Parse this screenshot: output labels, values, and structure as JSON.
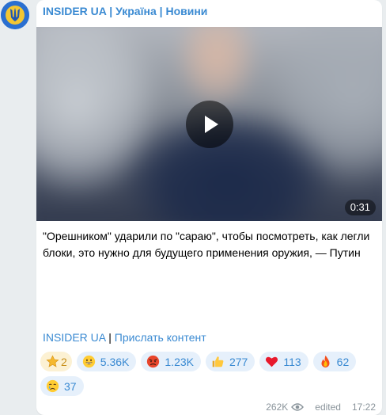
{
  "channel": {
    "name": "INSIDER UA | Україна | Новини"
  },
  "video": {
    "duration": "0:31"
  },
  "message": {
    "text": "\"Орешником\" ударили по \"сараю\", чтобы посмотреть, как легли блоки, это нужно для будущего применения оружия, — Путин",
    "footer_link_channel": "INSIDER UA",
    "footer_separator": " | ",
    "footer_link_submit": "Прислать контент"
  },
  "reactions": [
    {
      "emoji": "star-icon",
      "count": "2"
    },
    {
      "emoji": "grinning-face-icon",
      "count": "5.36K"
    },
    {
      "emoji": "angry-face-icon",
      "count": "1.23K"
    },
    {
      "emoji": "thumbs-up-icon",
      "count": "277"
    },
    {
      "emoji": "red-heart-icon",
      "count": "113"
    },
    {
      "emoji": "fire-icon",
      "count": "62"
    },
    {
      "emoji": "crying-face-icon",
      "count": "37"
    }
  ],
  "meta": {
    "views": "262K",
    "edited_label": "edited",
    "time": "17:22"
  },
  "colors": {
    "accent": "#3a8ad2",
    "background": "#e9edef",
    "reaction_bg": "#e6f0fb",
    "paid_reaction_bg": "#fcf1d3"
  }
}
